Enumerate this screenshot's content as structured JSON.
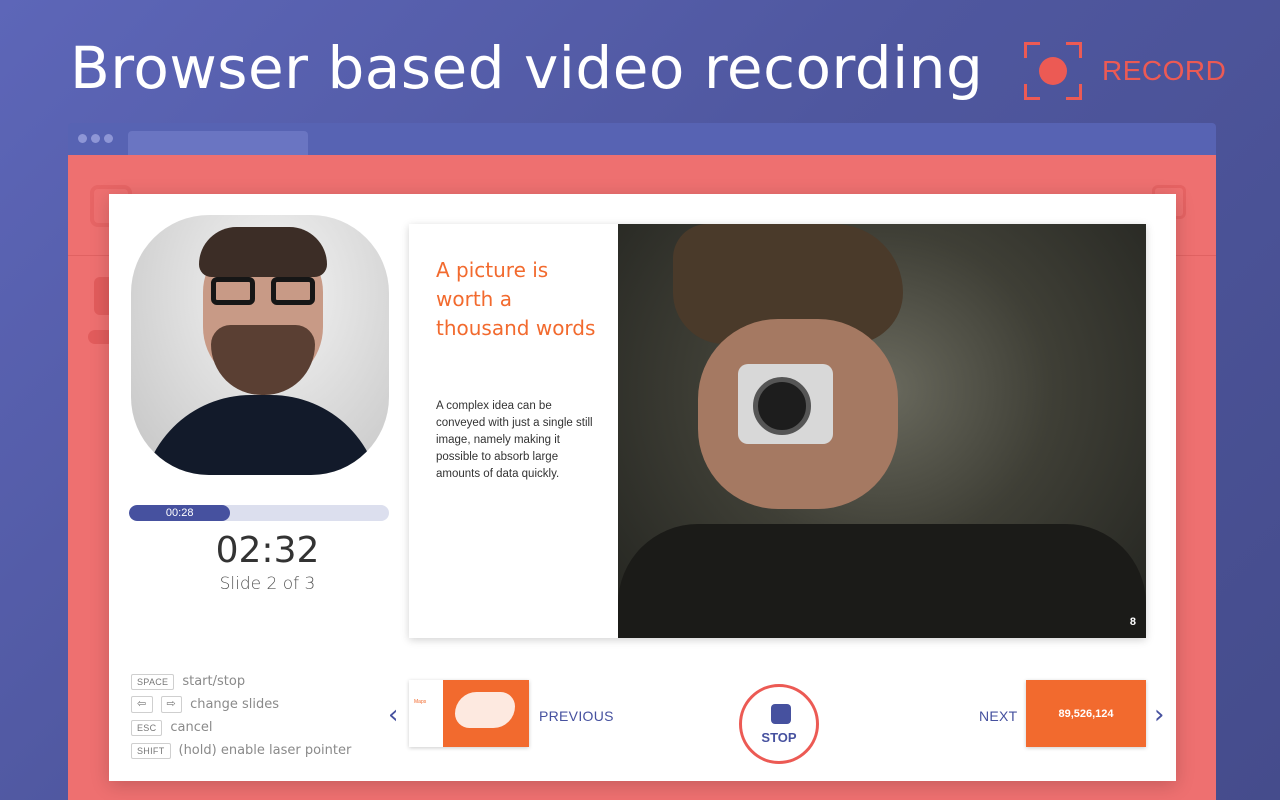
{
  "header": {
    "title": "Browser based video recording",
    "record_label": "RECORD"
  },
  "recorder": {
    "progress_text": "00:28",
    "progress_fraction": 0.39,
    "timer": "02:32",
    "slide_indicator": "Slide 2 of 3"
  },
  "shortcuts": [
    {
      "keys": [
        "SPACE"
      ],
      "action": "start/stop"
    },
    {
      "keys": [
        "⇦",
        "⇨"
      ],
      "action": "change slides"
    },
    {
      "keys": [
        "ESC"
      ],
      "action": "cancel"
    },
    {
      "keys": [
        "SHIFT"
      ],
      "action": "(hold) enable laser pointer"
    }
  ],
  "slide": {
    "title": "A picture is worth a thousand words",
    "body": "A complex idea can be conveyed with just a single still image, namely making it possible to absorb large amounts of data quickly.",
    "page_number": "8"
  },
  "navigation": {
    "previous_label": "PREVIOUS",
    "next_label": "NEXT",
    "stop_label": "STOP",
    "prev_thumb_title": "Maps",
    "next_thumb_value": "89,526,124"
  },
  "colors": {
    "accent": "#46519f",
    "record_red": "#ec5a54",
    "slide_orange": "#f26a2e"
  }
}
